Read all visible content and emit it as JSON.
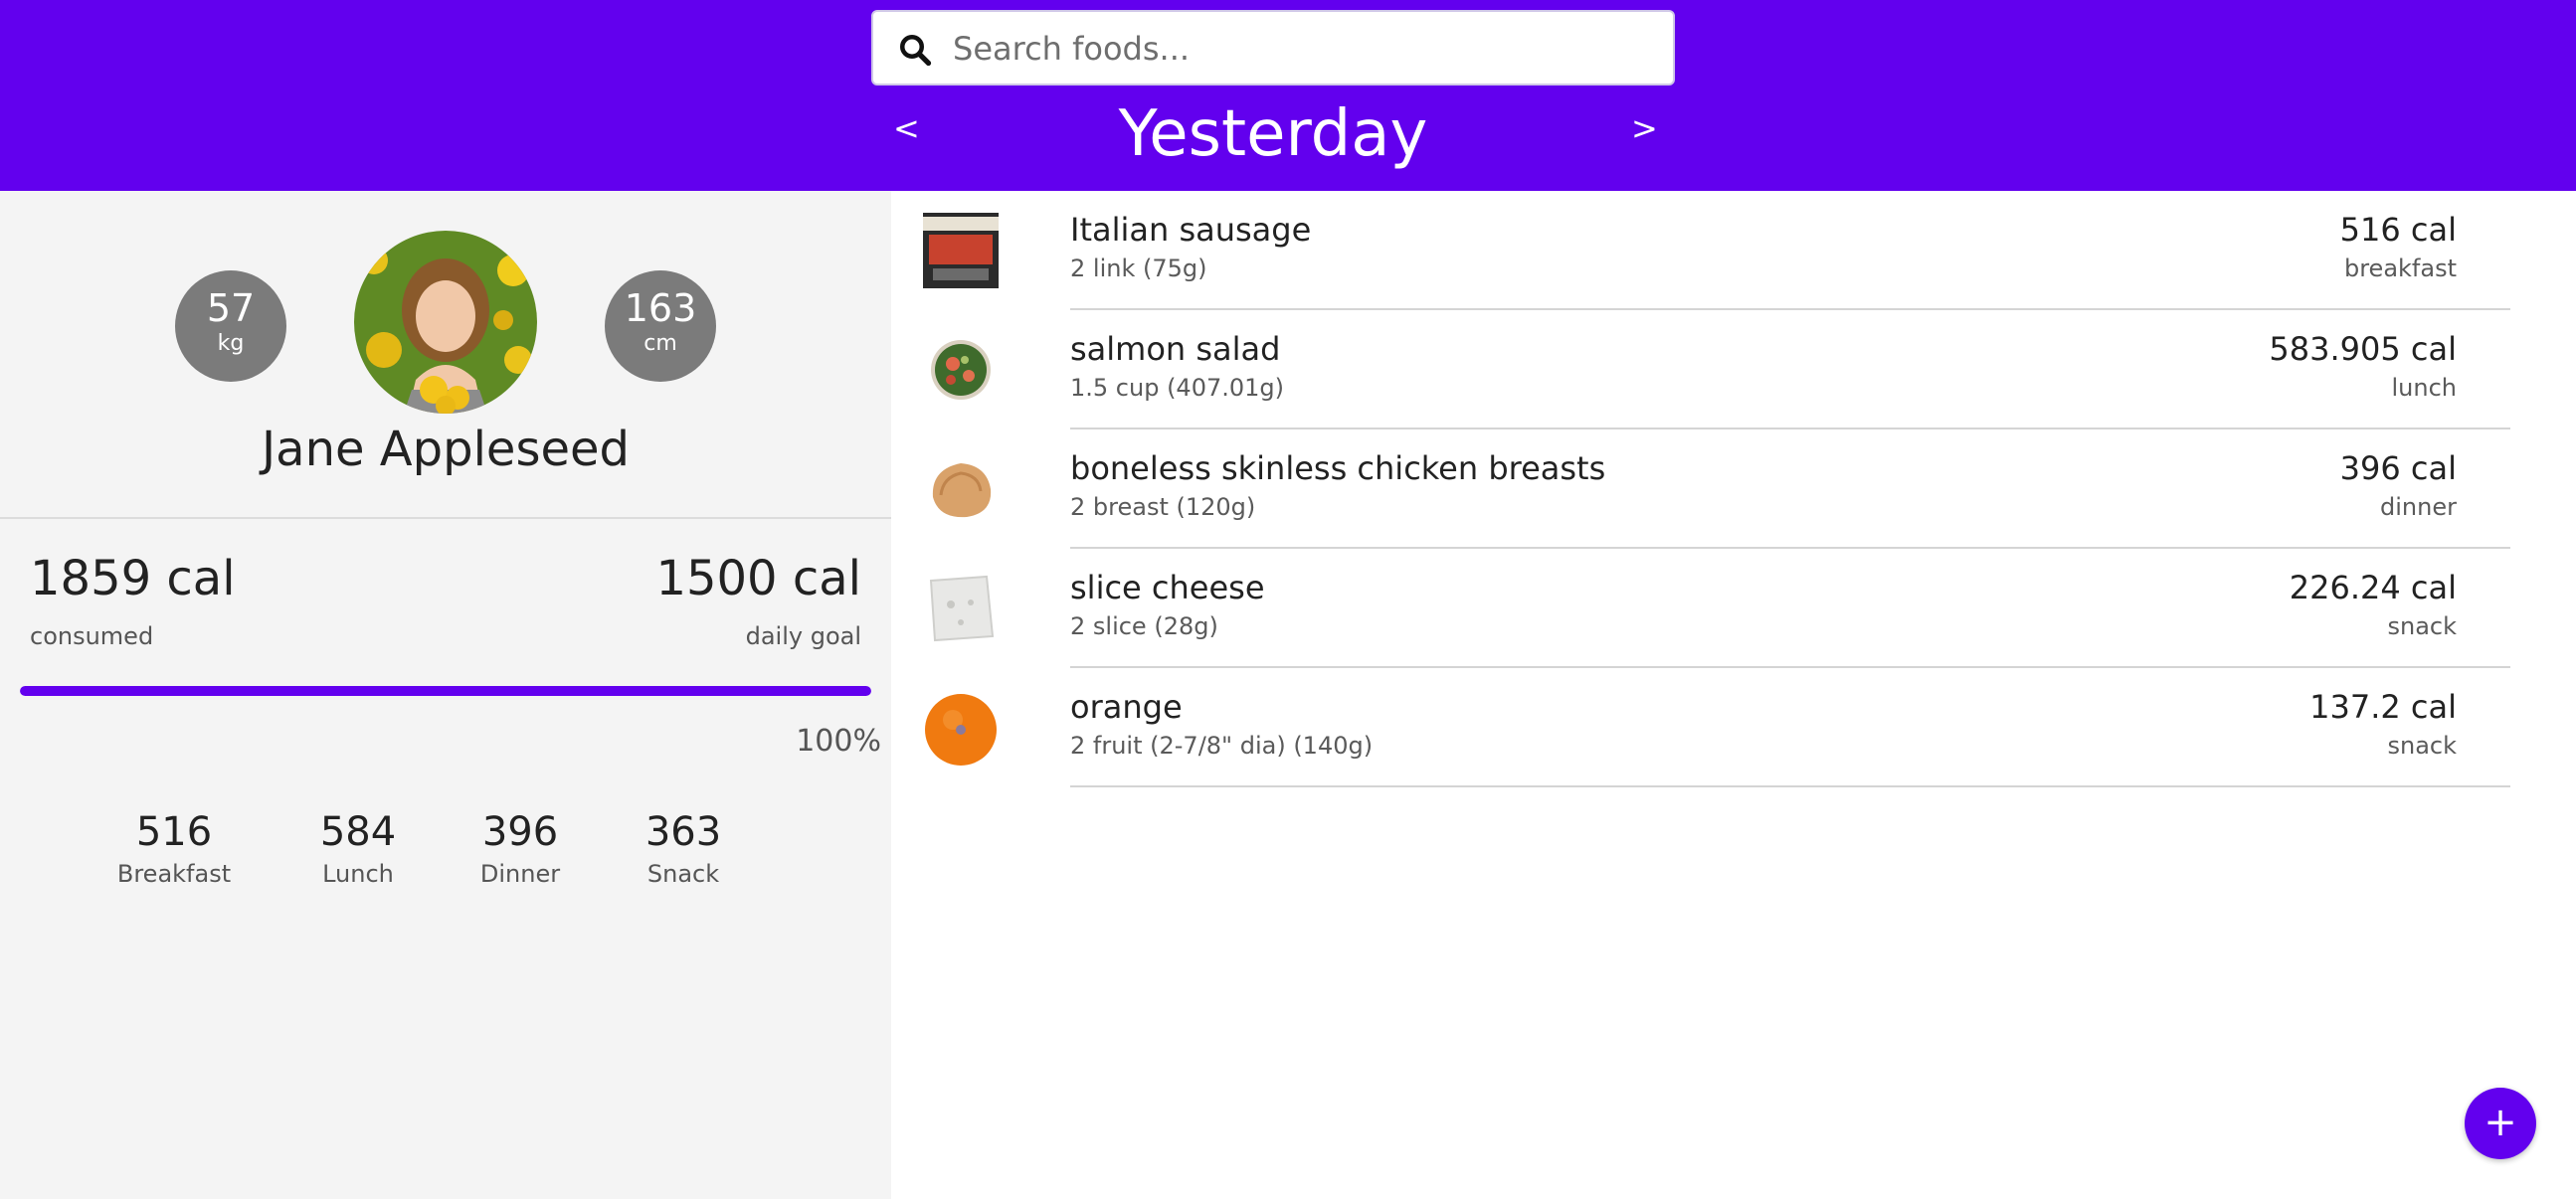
{
  "header": {
    "search_placeholder": "Search foods...",
    "prev_label": "<",
    "next_label": ">",
    "day_title": "Yesterday",
    "accent_color": "#6200ee"
  },
  "profile": {
    "weight_value": "57",
    "weight_unit": "kg",
    "height_value": "163",
    "height_unit": "cm",
    "name": "Jane Appleseed"
  },
  "calories": {
    "consumed_value": "1859 cal",
    "consumed_label": "consumed",
    "goal_value": "1500 cal",
    "goal_label": "daily goal",
    "progress_fraction": 1.0,
    "percent_text": "100%"
  },
  "meal_totals": [
    {
      "value": "516",
      "label": "Breakfast"
    },
    {
      "value": "584",
      "label": "Lunch"
    },
    {
      "value": "396",
      "label": "Dinner"
    },
    {
      "value": "363",
      "label": "Snack"
    }
  ],
  "foods": [
    {
      "name": "Italian sausage",
      "qty": "2 link (75g)",
      "cal": "516 cal",
      "meal": "breakfast",
      "icon": "sausage-package-icon"
    },
    {
      "name": "salmon salad",
      "qty": "1.5 cup (407.01g)",
      "cal": "583.905 cal",
      "meal": "lunch",
      "icon": "salad-bowl-icon"
    },
    {
      "name": "boneless skinless chicken breasts",
      "qty": "2 breast (120g)",
      "cal": "396 cal",
      "meal": "dinner",
      "icon": "chicken-breast-icon"
    },
    {
      "name": "slice cheese",
      "qty": "2 slice (28g)",
      "cal": "226.24 cal",
      "meal": "snack",
      "icon": "cheese-slice-icon"
    },
    {
      "name": "orange",
      "qty": "2 fruit (2-7/8\" dia) (140g)",
      "cal": "137.2 cal",
      "meal": "snack",
      "icon": "orange-icon"
    }
  ],
  "fab_label": "+"
}
